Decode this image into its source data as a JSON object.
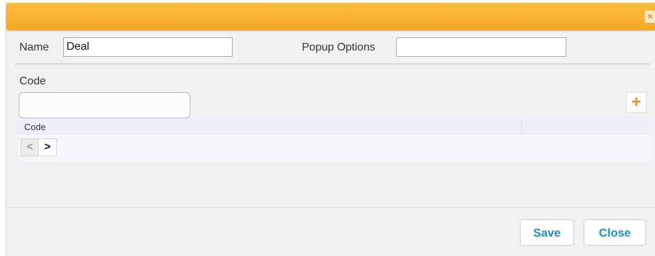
{
  "dialog": {
    "close_glyph": "×"
  },
  "form": {
    "name_label": "Name",
    "name_value": "Deal",
    "popup_options_label": "Popup Options",
    "popup_options_value": "",
    "code_label": "Code",
    "code_value": ""
  },
  "toolbar": {
    "add_glyph": "+"
  },
  "grid": {
    "columns": [
      "Code",
      ""
    ],
    "rows": [],
    "pager": {
      "prev_glyph": "<",
      "next_glyph": ">"
    }
  },
  "footer": {
    "save_label": "Save",
    "close_label": "Close"
  },
  "colors": {
    "titlebar": "#f5a623",
    "accent_orange": "#f08c1c",
    "button_text": "#1f8fc4",
    "background": "#f1f1f1"
  },
  "icons": {
    "close": "close-icon",
    "add": "plus-icon",
    "prev": "chevron-left-icon",
    "next": "chevron-right-icon"
  }
}
